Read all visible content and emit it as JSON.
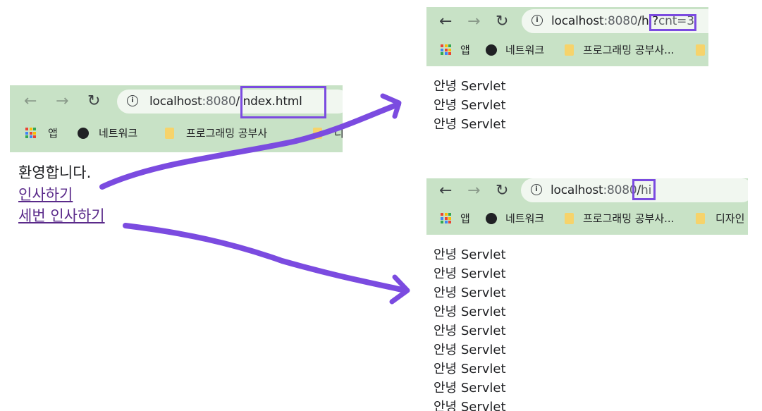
{
  "colors": {
    "chrome_bg": "#c8e2c6",
    "highlight": "#7b4be0",
    "link_visited": "#5a2a8a"
  },
  "icons": {
    "back": "arrow-left-icon",
    "forward": "arrow-right-icon",
    "reload": "reload-icon",
    "info": "info-icon",
    "apps": "apps-grid-icon",
    "globe": "globe-icon",
    "folder": "folder-icon"
  },
  "left_window": {
    "url_host": "localhost",
    "url_port": ":8080",
    "url_path": "/index.html",
    "bookmarks": [
      "앱",
      "네트워크",
      "프로그래밍 공부사",
      "디"
    ],
    "page": {
      "heading": "환영합니다.",
      "link1": "인사하기",
      "link2": "세번 인사하기"
    }
  },
  "top_right_window": {
    "url_host": "localhost",
    "url_port": ":8080",
    "url_path": "/hi?",
    "url_query": "cnt=3",
    "bookmarks": [
      "앱",
      "네트워크",
      "프로그래밍 공부사...",
      ""
    ],
    "lines": [
      "안녕 Servlet",
      "안녕 Servlet",
      "안녕 Servlet"
    ]
  },
  "bottom_right_window": {
    "url_host": "localhost",
    "url_port": ":8080",
    "url_path": "/",
    "url_highlight": "hi",
    "bookmarks": [
      "앱",
      "네트워크",
      "프로그래밍 공부사...",
      "디자인"
    ],
    "lines": [
      "안녕 Servlet",
      "안녕 Servlet",
      "안녕 Servlet",
      "안녕 Servlet",
      "안녕 Servlet",
      "안녕 Servlet",
      "안녕 Servlet",
      "안녕 Servlet",
      "안녕 Servlet"
    ]
  }
}
